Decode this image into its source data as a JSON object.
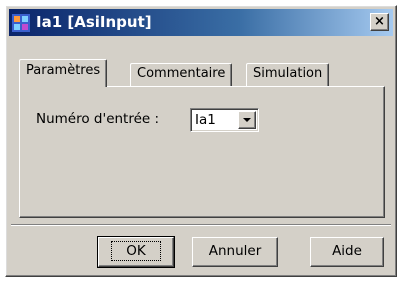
{
  "window": {
    "title": "Ia1 [AsiInput]",
    "close_glyph": "×",
    "icon": "app-block-icon"
  },
  "tabs": [
    {
      "label": "Paramètres",
      "active": true
    },
    {
      "label": "Commentaire",
      "active": false
    },
    {
      "label": "Simulation",
      "active": false
    }
  ],
  "parametres": {
    "input_label": "Numéro d'entrée :",
    "input_value": "Ia1"
  },
  "buttons": {
    "ok": "OK",
    "cancel": "Annuler",
    "help": "Aide"
  },
  "colors": {
    "titlebar_start": "#0a246a",
    "titlebar_end": "#a6caf0",
    "dialog_bg": "#d4d0c8"
  }
}
